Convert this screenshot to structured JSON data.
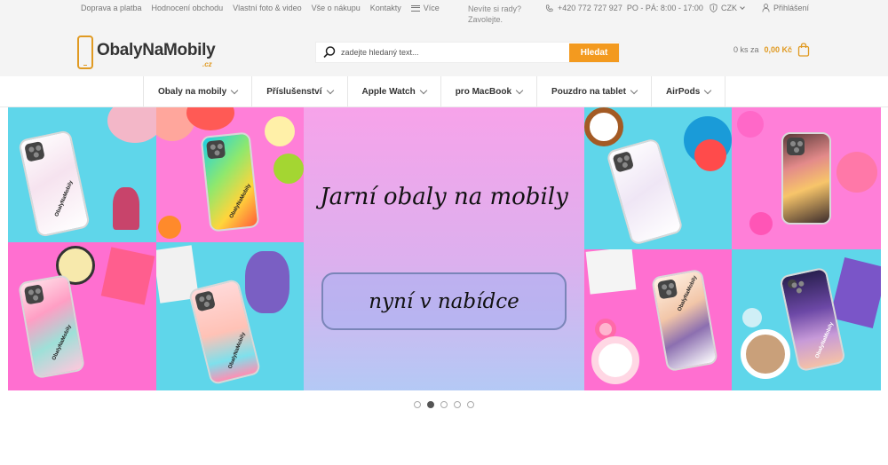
{
  "top_links": [
    "Doprava a platba",
    "Hodnocení obchodu",
    "Vlastní foto & video",
    "Vše o nákupu",
    "Kontakty"
  ],
  "more_label": "Více",
  "advice": {
    "line1": "Nevíte si rady?",
    "line2": "Zavolejte."
  },
  "phone": {
    "number": "+420 772 727 927",
    "hours": "PO - PÁ: 8:00 - 17:00"
  },
  "currency": "CZK",
  "login_label": "Přihlášení",
  "logo": {
    "name": "ObalyNaMobily",
    "tld": ".cz"
  },
  "search": {
    "placeholder": "zadejte hledaný text...",
    "button": "Hledat"
  },
  "cart": {
    "count": "0 ks za",
    "price": "0,00 Kč"
  },
  "nav": [
    "Obaly na mobily",
    "Příslušenství",
    "Apple Watch",
    "pro MacBook",
    "Pouzdro na tablet",
    "AirPods"
  ],
  "banner": {
    "headline": "Jarní obaly na mobily",
    "cta": "nyní v nabídce",
    "case_brand": "ObalyNaMobily",
    "slides": 5,
    "active_slide": 2
  },
  "colors": {
    "accent": "#f39a1f",
    "cyan": "#5fd6ea",
    "pink": "#ff7fd8"
  }
}
